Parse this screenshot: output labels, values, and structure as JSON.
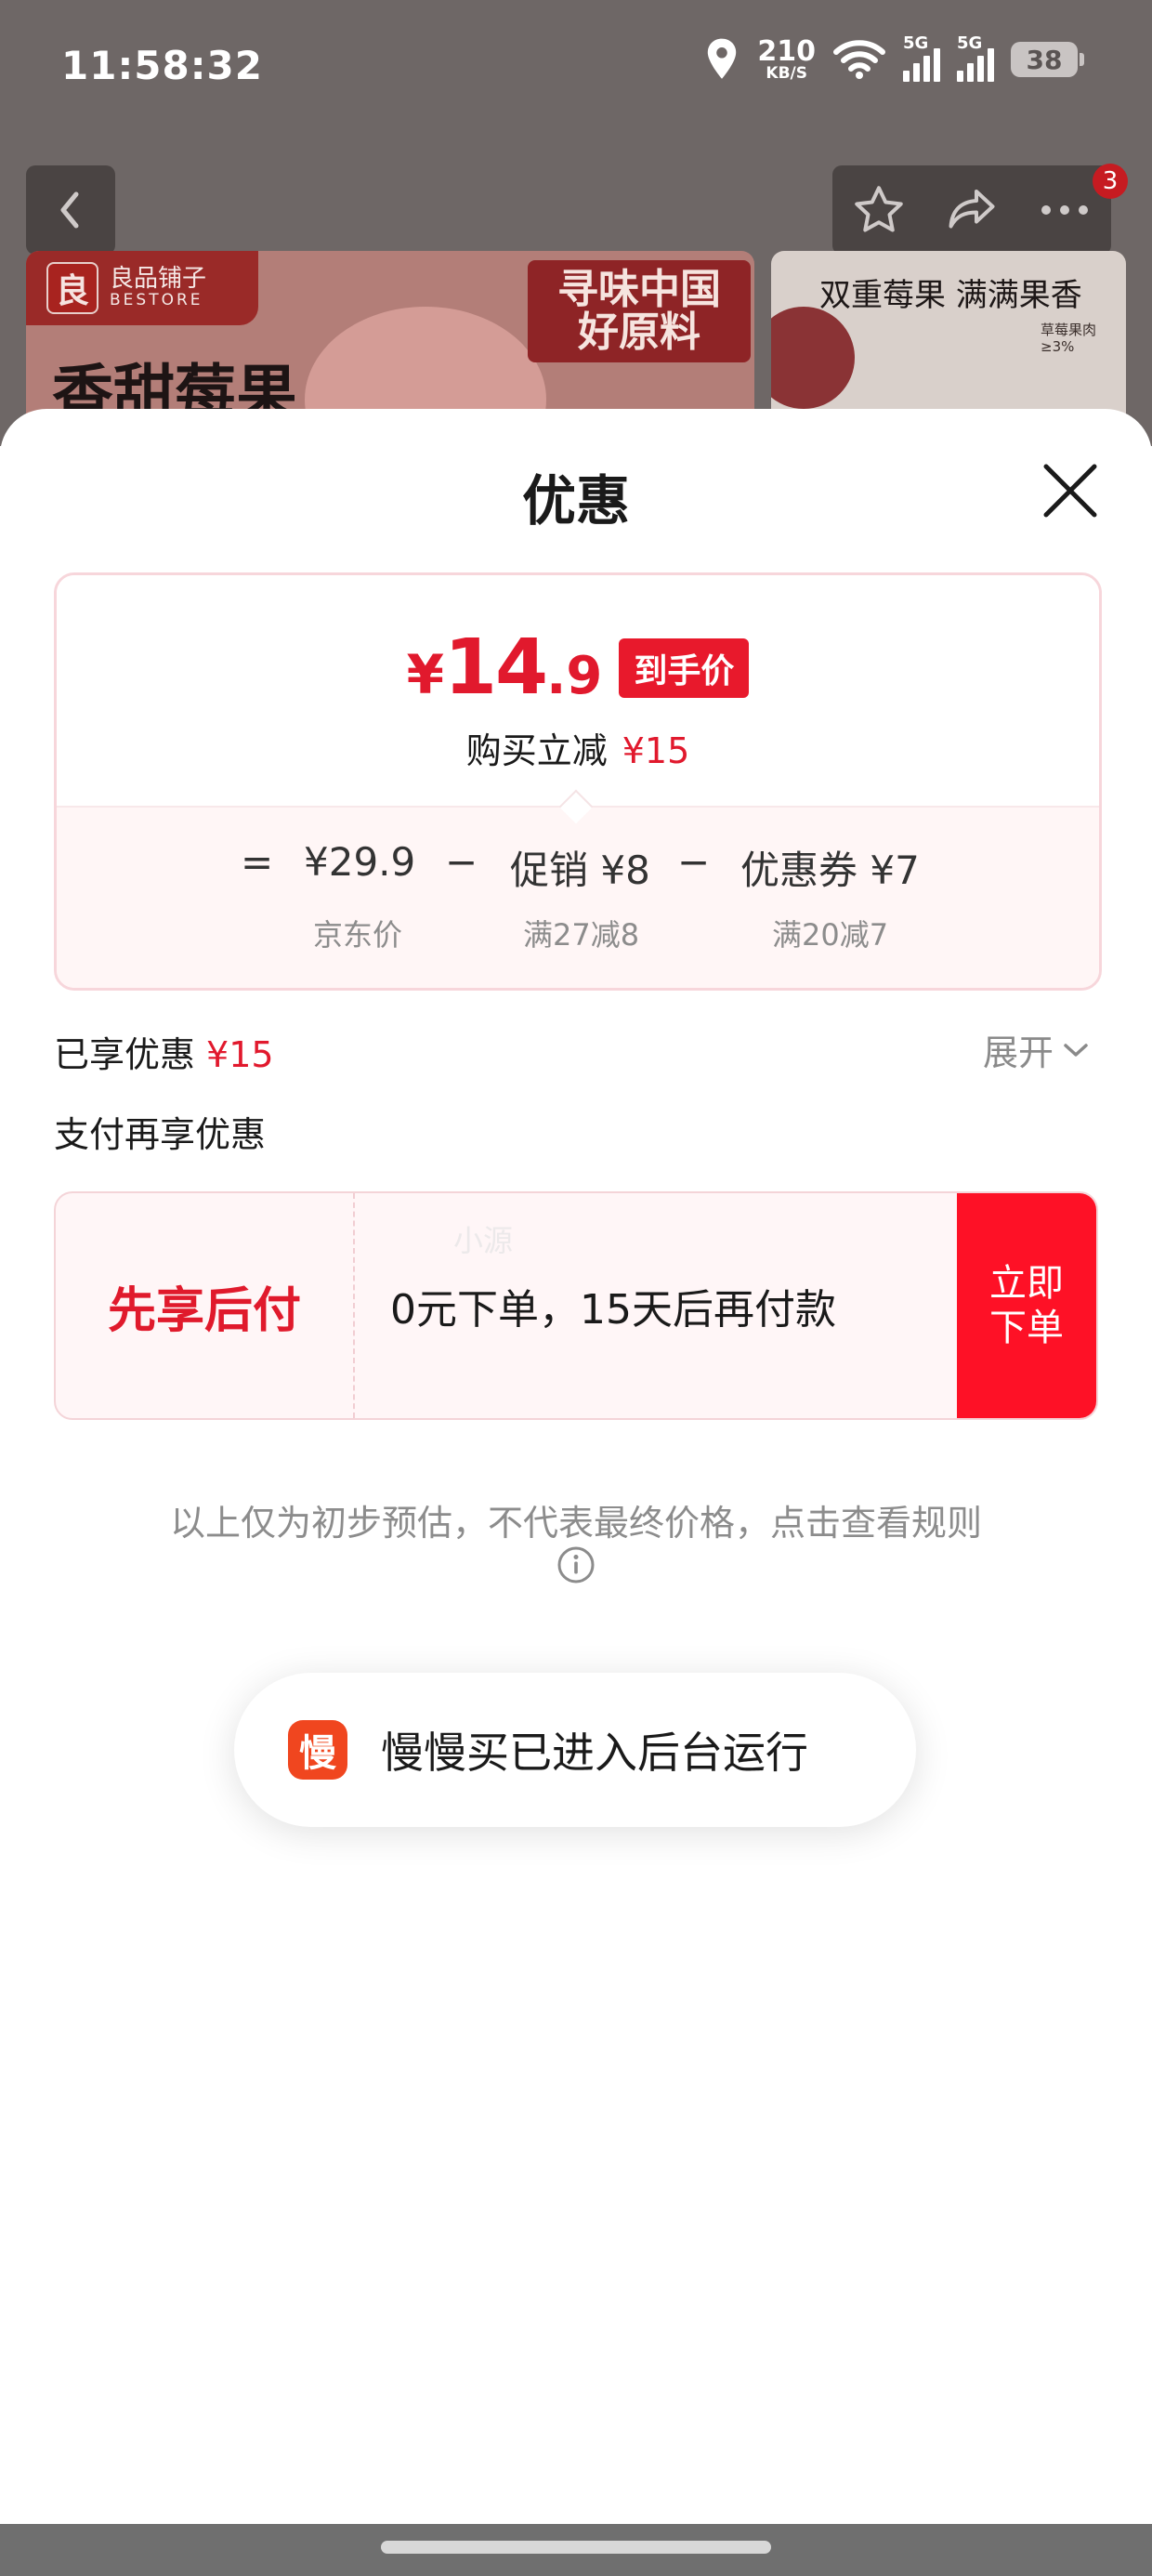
{
  "status_bar": {
    "time": "11:58:32",
    "net_speed": "210",
    "net_unit": "KB/S",
    "signal_label_1": "5G",
    "signal_label_2": "5G",
    "battery": "38"
  },
  "background": {
    "badge_count": "3",
    "brand_name": "良品铺子",
    "brand_en": "BESTORE",
    "brand_mark": "良",
    "banner_title": "香甜莓果",
    "slogan_line1": "寻味中国",
    "slogan_line2": "好原料",
    "right_banner_title": "双重莓果 满满果香",
    "right_banner_note": "草莓果肉≥3%"
  },
  "sheet": {
    "title": "优惠",
    "final_price": {
      "currency": "¥",
      "integer": "14",
      "decimal": ".9"
    },
    "hand_price_tag": "到手价",
    "reduce_label": "购买立减",
    "reduce_amount": "¥15",
    "calc": {
      "equals": "=",
      "jd_price": "¥29.9",
      "jd_price_label": "京东价",
      "minus1": "−",
      "promo": "促销 ¥8",
      "promo_label": "满27减8",
      "minus2": "−",
      "coupon": "优惠券 ¥7",
      "coupon_label": "满20减7"
    },
    "enjoyed_label": "已享优惠",
    "enjoyed_amount": "¥15",
    "expand_label": "展开",
    "pay_more_label": "支付再享优惠",
    "bnpl": {
      "title": "先享后付",
      "description": "0元下单，15天后再付款",
      "button": "立即下单",
      "watermark": "小源"
    },
    "disclaimer": "以上仅为初步预估，不代表最终价格，点击查看规则"
  },
  "toast": {
    "icon_char": "慢",
    "text": "慢慢买已进入后台运行"
  },
  "colors": {
    "accent_red": "#e1192d",
    "button_red": "#fe1126",
    "card_border": "#f7d6db"
  }
}
